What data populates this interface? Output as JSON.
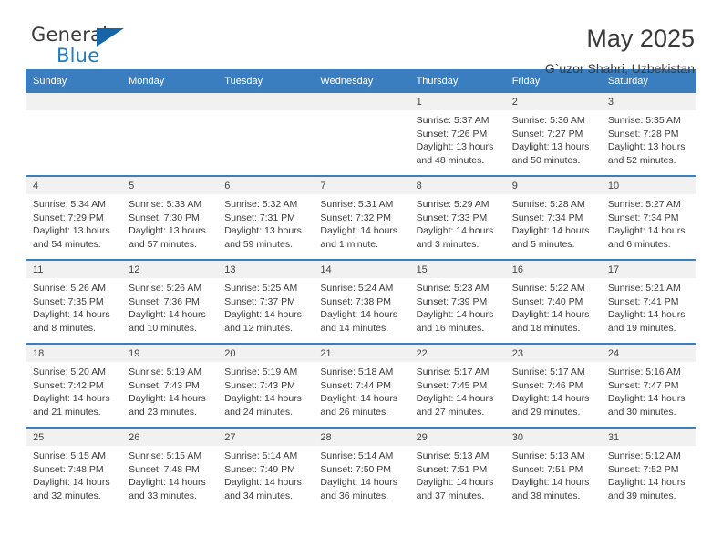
{
  "brand": {
    "name_part1": "General",
    "name_part2": "Blue",
    "mark": "triangle-logo"
  },
  "header": {
    "title": "May 2025",
    "subtitle": "G`uzor Shahri, Uzbekistan"
  },
  "calendar": {
    "weekday_headers": [
      "Sunday",
      "Monday",
      "Tuesday",
      "Wednesday",
      "Thursday",
      "Friday",
      "Saturday"
    ],
    "colors": {
      "header_blue": "#3a7ebf",
      "daynum_band": "#f1f1f1",
      "text": "#3b3b3b",
      "brand_blue": "#1f7ec4"
    },
    "weeks": [
      [
        {
          "day": "",
          "lines": []
        },
        {
          "day": "",
          "lines": []
        },
        {
          "day": "",
          "lines": []
        },
        {
          "day": "",
          "lines": []
        },
        {
          "day": "1",
          "lines": [
            "Sunrise: 5:37 AM",
            "Sunset: 7:26 PM",
            "Daylight: 13 hours",
            "and 48 minutes."
          ]
        },
        {
          "day": "2",
          "lines": [
            "Sunrise: 5:36 AM",
            "Sunset: 7:27 PM",
            "Daylight: 13 hours",
            "and 50 minutes."
          ]
        },
        {
          "day": "3",
          "lines": [
            "Sunrise: 5:35 AM",
            "Sunset: 7:28 PM",
            "Daylight: 13 hours",
            "and 52 minutes."
          ]
        }
      ],
      [
        {
          "day": "4",
          "lines": [
            "Sunrise: 5:34 AM",
            "Sunset: 7:29 PM",
            "Daylight: 13 hours",
            "and 54 minutes."
          ]
        },
        {
          "day": "5",
          "lines": [
            "Sunrise: 5:33 AM",
            "Sunset: 7:30 PM",
            "Daylight: 13 hours",
            "and 57 minutes."
          ]
        },
        {
          "day": "6",
          "lines": [
            "Sunrise: 5:32 AM",
            "Sunset: 7:31 PM",
            "Daylight: 13 hours",
            "and 59 minutes."
          ]
        },
        {
          "day": "7",
          "lines": [
            "Sunrise: 5:31 AM",
            "Sunset: 7:32 PM",
            "Daylight: 14 hours",
            "and 1 minute."
          ]
        },
        {
          "day": "8",
          "lines": [
            "Sunrise: 5:29 AM",
            "Sunset: 7:33 PM",
            "Daylight: 14 hours",
            "and 3 minutes."
          ]
        },
        {
          "day": "9",
          "lines": [
            "Sunrise: 5:28 AM",
            "Sunset: 7:34 PM",
            "Daylight: 14 hours",
            "and 5 minutes."
          ]
        },
        {
          "day": "10",
          "lines": [
            "Sunrise: 5:27 AM",
            "Sunset: 7:34 PM",
            "Daylight: 14 hours",
            "and 6 minutes."
          ]
        }
      ],
      [
        {
          "day": "11",
          "lines": [
            "Sunrise: 5:26 AM",
            "Sunset: 7:35 PM",
            "Daylight: 14 hours",
            "and 8 minutes."
          ]
        },
        {
          "day": "12",
          "lines": [
            "Sunrise: 5:26 AM",
            "Sunset: 7:36 PM",
            "Daylight: 14 hours",
            "and 10 minutes."
          ]
        },
        {
          "day": "13",
          "lines": [
            "Sunrise: 5:25 AM",
            "Sunset: 7:37 PM",
            "Daylight: 14 hours",
            "and 12 minutes."
          ]
        },
        {
          "day": "14",
          "lines": [
            "Sunrise: 5:24 AM",
            "Sunset: 7:38 PM",
            "Daylight: 14 hours",
            "and 14 minutes."
          ]
        },
        {
          "day": "15",
          "lines": [
            "Sunrise: 5:23 AM",
            "Sunset: 7:39 PM",
            "Daylight: 14 hours",
            "and 16 minutes."
          ]
        },
        {
          "day": "16",
          "lines": [
            "Sunrise: 5:22 AM",
            "Sunset: 7:40 PM",
            "Daylight: 14 hours",
            "and 18 minutes."
          ]
        },
        {
          "day": "17",
          "lines": [
            "Sunrise: 5:21 AM",
            "Sunset: 7:41 PM",
            "Daylight: 14 hours",
            "and 19 minutes."
          ]
        }
      ],
      [
        {
          "day": "18",
          "lines": [
            "Sunrise: 5:20 AM",
            "Sunset: 7:42 PM",
            "Daylight: 14 hours",
            "and 21 minutes."
          ]
        },
        {
          "day": "19",
          "lines": [
            "Sunrise: 5:19 AM",
            "Sunset: 7:43 PM",
            "Daylight: 14 hours",
            "and 23 minutes."
          ]
        },
        {
          "day": "20",
          "lines": [
            "Sunrise: 5:19 AM",
            "Sunset: 7:43 PM",
            "Daylight: 14 hours",
            "and 24 minutes."
          ]
        },
        {
          "day": "21",
          "lines": [
            "Sunrise: 5:18 AM",
            "Sunset: 7:44 PM",
            "Daylight: 14 hours",
            "and 26 minutes."
          ]
        },
        {
          "day": "22",
          "lines": [
            "Sunrise: 5:17 AM",
            "Sunset: 7:45 PM",
            "Daylight: 14 hours",
            "and 27 minutes."
          ]
        },
        {
          "day": "23",
          "lines": [
            "Sunrise: 5:17 AM",
            "Sunset: 7:46 PM",
            "Daylight: 14 hours",
            "and 29 minutes."
          ]
        },
        {
          "day": "24",
          "lines": [
            "Sunrise: 5:16 AM",
            "Sunset: 7:47 PM",
            "Daylight: 14 hours",
            "and 30 minutes."
          ]
        }
      ],
      [
        {
          "day": "25",
          "lines": [
            "Sunrise: 5:15 AM",
            "Sunset: 7:48 PM",
            "Daylight: 14 hours",
            "and 32 minutes."
          ]
        },
        {
          "day": "26",
          "lines": [
            "Sunrise: 5:15 AM",
            "Sunset: 7:48 PM",
            "Daylight: 14 hours",
            "and 33 minutes."
          ]
        },
        {
          "day": "27",
          "lines": [
            "Sunrise: 5:14 AM",
            "Sunset: 7:49 PM",
            "Daylight: 14 hours",
            "and 34 minutes."
          ]
        },
        {
          "day": "28",
          "lines": [
            "Sunrise: 5:14 AM",
            "Sunset: 7:50 PM",
            "Daylight: 14 hours",
            "and 36 minutes."
          ]
        },
        {
          "day": "29",
          "lines": [
            "Sunrise: 5:13 AM",
            "Sunset: 7:51 PM",
            "Daylight: 14 hours",
            "and 37 minutes."
          ]
        },
        {
          "day": "30",
          "lines": [
            "Sunrise: 5:13 AM",
            "Sunset: 7:51 PM",
            "Daylight: 14 hours",
            "and 38 minutes."
          ]
        },
        {
          "day": "31",
          "lines": [
            "Sunrise: 5:12 AM",
            "Sunset: 7:52 PM",
            "Daylight: 14 hours",
            "and 39 minutes."
          ]
        }
      ]
    ]
  }
}
